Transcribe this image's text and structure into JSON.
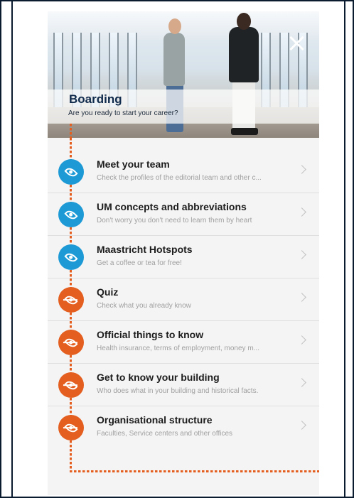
{
  "header": {
    "title": "Boarding",
    "subtitle": "Are you ready to start your career?"
  },
  "colors": {
    "seen": "#1d9ad6",
    "unseen": "#e35e1f",
    "title_text": "#0f2a4a"
  },
  "items": [
    {
      "title": "Meet your team",
      "subtitle": "Check the profiles of the editorial team and other c...",
      "status": "seen",
      "icon": "eye-icon"
    },
    {
      "title": "UM concepts and abbreviations",
      "subtitle": "Don't worry you don't need to learn them by heart",
      "status": "seen",
      "icon": "eye-icon"
    },
    {
      "title": "Maastricht Hotspots",
      "subtitle": "Get a coffee or tea for free!",
      "status": "seen",
      "icon": "eye-icon"
    },
    {
      "title": "Quiz",
      "subtitle": "Check what you already know",
      "status": "unseen",
      "icon": "eye-slash-icon"
    },
    {
      "title": "Official things to know",
      "subtitle": "Health insurance, terms of employment, money m...",
      "status": "unseen",
      "icon": "eye-slash-icon"
    },
    {
      "title": "Get to know your building",
      "subtitle": "Who does what in your building and historical facts.",
      "status": "unseen",
      "icon": "eye-slash-icon"
    },
    {
      "title": "Organisational structure",
      "subtitle": "Faculties, Service centers and other offices",
      "status": "unseen",
      "icon": "eye-slash-icon"
    }
  ]
}
